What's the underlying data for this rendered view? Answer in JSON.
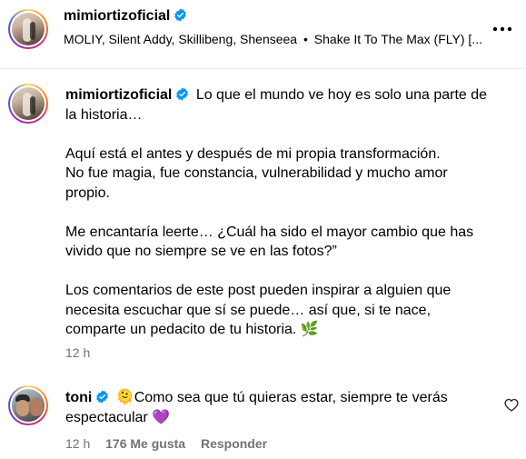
{
  "header": {
    "username": "mimiortizoficial",
    "audio": "MOLIY, Silent Addy, Skillibeng, Shenseea",
    "separator": "•",
    "track": "Shake It To The Max (FLY) [...",
    "more_icon": "more-horizontal-icon"
  },
  "caption": {
    "username": "mimiortizoficial",
    "line1": "Lo que el mundo ve hoy es solo una parte de",
    "line2": "la historia…",
    "p2_line1": "Aquí está el antes y después de mi propia transformación.",
    "p2_line2": "No fue magia, fue constancia, vulnerabilidad y mucho amor",
    "p2_line3": "propio.",
    "p3_line1": "Me encantaría leerte… ¿Cuál ha sido el mayor cambio que has",
    "p3_line2": "vivido que no siempre se ve en las fotos?”",
    "p4_line1": "Los comentarios de este post pueden inspirar a alguien que",
    "p4_line2": "necesita escuchar que sí se puede… así que, si te nace,",
    "p4_line3": "comparte un pedacito de tu historia. 🌿",
    "time": "12 h"
  },
  "comment": {
    "username": "toni",
    "text_line1": "🫠Como sea que tú quieras estar, siempre te verás",
    "text_line2": "espectacular 💜",
    "time": "12 h",
    "likes": "176 Me gusta",
    "reply": "Responder",
    "like_icon": "heart-outline-icon"
  },
  "colors": {
    "verified": "#0095f6",
    "muted": "#737373",
    "divider": "#efefef"
  }
}
